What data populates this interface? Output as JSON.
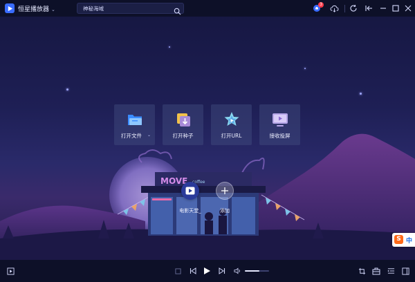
{
  "app": {
    "title": "恒星播放器",
    "accent": "#3a6cff"
  },
  "search": {
    "value": "神秘海域",
    "icon": "search-icon"
  },
  "titlebar_icons": {
    "notification_count": "3",
    "icons": [
      "notification-icon",
      "cloud-download-icon",
      "refresh-icon",
      "pin-icon",
      "minimize-icon",
      "maximize-icon",
      "close-icon"
    ]
  },
  "actions": [
    {
      "label": "打开文件",
      "icon": "folder-icon",
      "has_dropdown": true
    },
    {
      "label": "打开种子",
      "icon": "torrent-icon"
    },
    {
      "label": "打开URL",
      "icon": "url-icon"
    },
    {
      "label": "接收投屏",
      "icon": "cast-icon"
    }
  ],
  "scene": {
    "sign_text": "MOVE",
    "sign_sub": "coffee"
  },
  "shortcuts": [
    {
      "label": "电影天堂_",
      "icon": "play-icon"
    },
    {
      "label": "添加",
      "icon": "plus-icon"
    }
  ],
  "ime": {
    "logo": "S",
    "mode": "中"
  },
  "controls": {
    "volume_level": 0.6,
    "icons": [
      "open-file-icon",
      "stop-icon",
      "previous-icon",
      "play-icon",
      "next-icon",
      "volume-icon",
      "screenshot-icon",
      "toolbox-icon",
      "playlist-icon",
      "fullscreen-icon"
    ]
  }
}
